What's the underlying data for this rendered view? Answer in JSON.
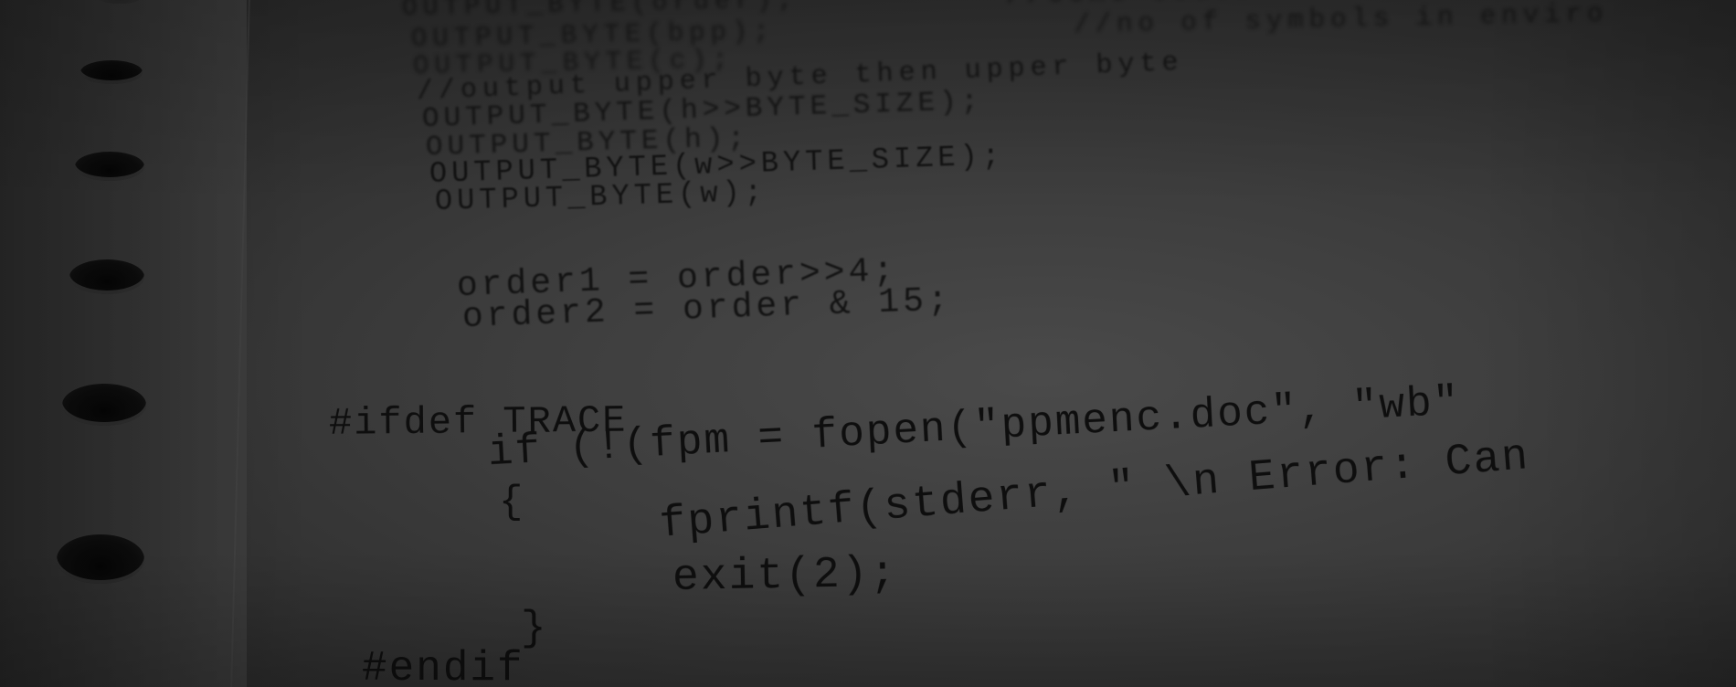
{
  "code_lines": {
    "l1": "OUTPUT_BYTE(order);          //some codes",
    "l2": "OUTPUT_BYTE(bpp);              //no of symbols in enviro",
    "l3": "OUTPUT_BYTE(c);",
    "l4": "//output upper byte then upper byte",
    "l5": "OUTPUT_BYTE(h>>BYTE_SIZE);",
    "l6": "OUTPUT_BYTE(h);",
    "l7": "OUTPUT_BYTE(w>>BYTE_SIZE);",
    "l8": "OUTPUT_BYTE(w);",
    "l9": "order1 = order>>4;",
    "l10": "order2 = order & 15;",
    "l11": "#ifdef TRACE",
    "l12": "if (!(fpm = fopen(\"ppmenc.doc\", \"wb\"",
    "l13": "{",
    "l14": "fprintf(stderr, \" \\n Error: Can",
    "l15": "exit(2);",
    "l16": "}",
    "l17": "#endif"
  },
  "colors": {
    "ink": "#0e0e0e",
    "paper": "#4a4a4a"
  }
}
